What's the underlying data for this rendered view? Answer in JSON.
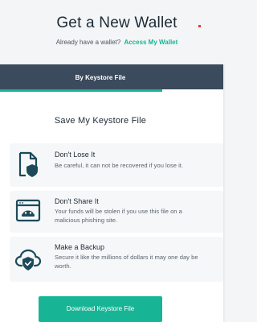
{
  "header": {
    "title": "Get a New Wallet",
    "subtitle_prefix": "Already have a wallet?",
    "access_link": "Access My Wallet"
  },
  "tab": {
    "label": "By Keystore File"
  },
  "main": {
    "section_title": "Save My Keystore File",
    "items": [
      {
        "heading": "Don't Lose It",
        "description": "Be careful, it can not be recovered if you lose it.",
        "icon": "file-shield-icon"
      },
      {
        "heading": "Don't Share It",
        "description": "Your funds will be stolen if you use this file on a malicious phishing site.",
        "icon": "phishing-browser-icon"
      },
      {
        "heading": "Make a Backup",
        "description": "Secure it like the millions of dollars it may one day be worth.",
        "icon": "cloud-shield-icon"
      }
    ],
    "download_button": "Download Keystore File"
  },
  "colors": {
    "accent": "#17b596",
    "tab_bg": "#3b4a5c",
    "icon": "#1d4a5a",
    "text_dark": "#1d2a36"
  }
}
